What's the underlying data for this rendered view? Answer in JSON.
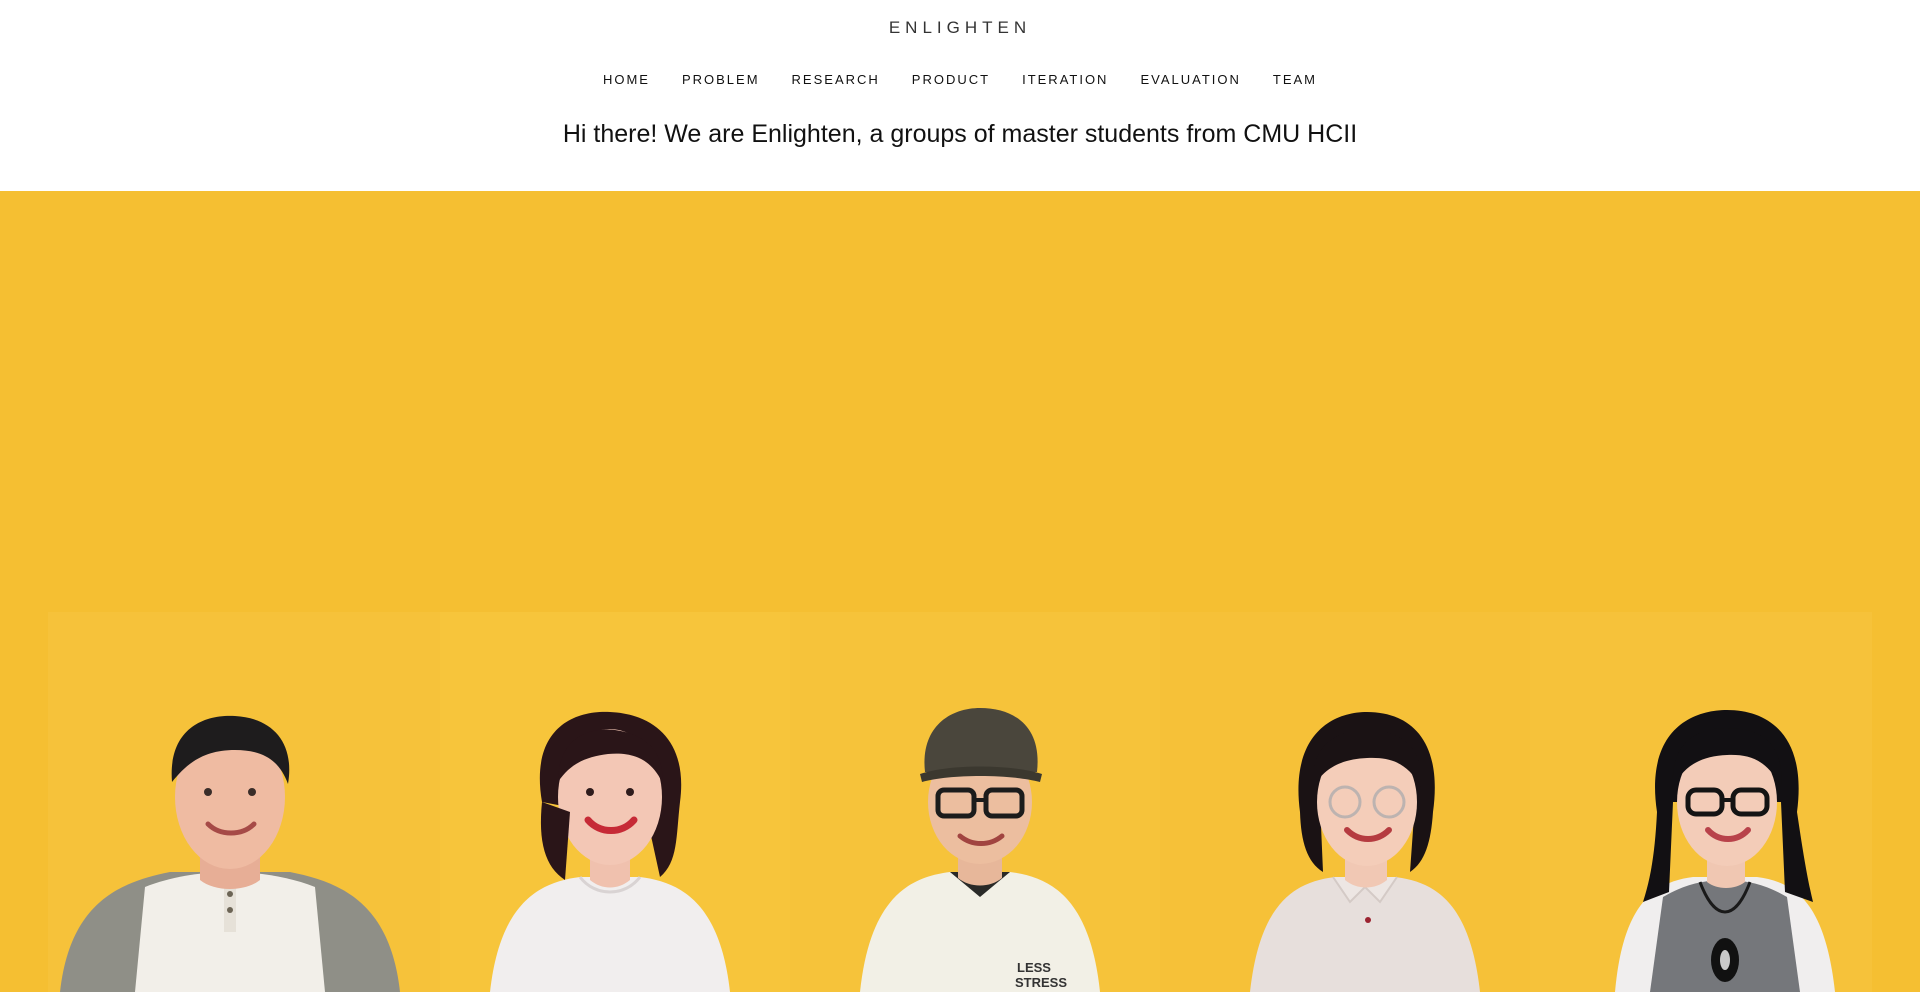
{
  "header": {
    "brand": "ENLIGHTEN",
    "nav": [
      "HOME",
      "PROBLEM",
      "RESEARCH",
      "PRODUCT",
      "ITERATION",
      "EVALUATION",
      "TEAM"
    ],
    "tagline": "Hi there! We are Enlighten, a groups of master students from CMU HCII"
  },
  "hero": {
    "background_color": "#f5bf32",
    "team_photos": [
      {
        "shirt_color": "#f2efe9",
        "sleeve_color": "#8f8f87",
        "accessory": "none"
      },
      {
        "shirt_color": "#f1eeee",
        "sleeve_color": "#f1eeee",
        "accessory": "none"
      },
      {
        "shirt_color": "#f2f0e6",
        "sleeve_color": "#f2f0e6",
        "accessory": "cap-and-glasses",
        "shirt_text": "LESS STRESS"
      },
      {
        "shirt_color": "#e7dfdc",
        "sleeve_color": "#e7dfdc",
        "accessory": "glasses"
      },
      {
        "shirt_color": "#75777b",
        "sleeve_color": "#f0eeee",
        "accessory": "glasses-and-pendant"
      }
    ]
  }
}
